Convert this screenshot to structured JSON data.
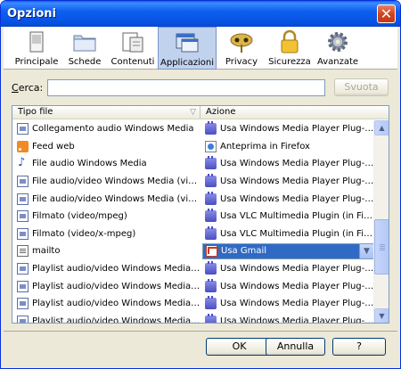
{
  "window": {
    "title": "Opzioni",
    "close_glyph": "✕"
  },
  "toolbar": {
    "items": [
      {
        "label": "Principale",
        "icon": "window-icon"
      },
      {
        "label": "Schede",
        "icon": "folder-tabs-icon"
      },
      {
        "label": "Contenuti",
        "icon": "document-icon"
      },
      {
        "label": "Applicazioni",
        "icon": "applications-icon",
        "selected": true
      },
      {
        "label": "Privacy",
        "icon": "mask-icon"
      },
      {
        "label": "Sicurezza",
        "icon": "lock-icon"
      },
      {
        "label": "Avanzate",
        "icon": "gear-icon"
      }
    ]
  },
  "search": {
    "label_prefix": "C",
    "label_rest": "erca:",
    "value": "",
    "clear_button": "Svuota"
  },
  "list": {
    "headers": {
      "type": "Tipo file",
      "action": "Azione"
    },
    "rows": [
      {
        "type": "Collegamento audio Windows Media",
        "type_icon": "media",
        "action": "Usa Windows Media Player Plug-in Dyn...",
        "action_icon": "plug"
      },
      {
        "type": "Feed web",
        "type_icon": "feed",
        "action": "Anteprima in Firefox",
        "action_icon": "preview"
      },
      {
        "type": "File audio Windows Media",
        "type_icon": "note",
        "action": "Usa Windows Media Player Plug-in Dyn...",
        "action_icon": "plug"
      },
      {
        "type": "File audio/video Windows Media (video...",
        "type_icon": "media",
        "action": "Usa Windows Media Player Plug-in Dyn...",
        "action_icon": "plug"
      },
      {
        "type": "File audio/video Windows Media (video...",
        "type_icon": "media",
        "action": "Usa Windows Media Player Plug-in Dyn...",
        "action_icon": "plug"
      },
      {
        "type": "Filmato (video/mpeg)",
        "type_icon": "media",
        "action": "Usa VLC Multimedia Plugin (in Firefox)",
        "action_icon": "plug"
      },
      {
        "type": "Filmato (video/x-mpeg)",
        "type_icon": "media",
        "action": "Usa VLC Multimedia Plugin (in Firefox)",
        "action_icon": "plug"
      },
      {
        "type": "mailto",
        "type_icon": "mailto",
        "action": "Usa Gmail",
        "action_icon": "gmail",
        "selected": true
      },
      {
        "type": "Playlist audio/video Windows Media (ap...",
        "type_icon": "media",
        "action": "Usa Windows Media Player Plug-in Dyn...",
        "action_icon": "plug"
      },
      {
        "type": "Playlist audio/video Windows Media (vi...",
        "type_icon": "media",
        "action": "Usa Windows Media Player Plug-in Dyn...",
        "action_icon": "plug"
      },
      {
        "type": "Playlist audio/video Windows Media (vi...",
        "type_icon": "media",
        "action": "Usa Windows Media Player Plug-in Dyn...",
        "action_icon": "plug"
      },
      {
        "type": "Playlist audio/video Windows Media (vi...",
        "type_icon": "media",
        "action": "Usa Windows Media Player Plug-in Dyn...",
        "action_icon": "plug"
      }
    ]
  },
  "footer": {
    "ok": "OK",
    "cancel": "Annulla",
    "help": "?"
  },
  "colors": {
    "selection": "#316ac5",
    "title_bar": "#0a5ef0",
    "face": "#ece9d8"
  }
}
